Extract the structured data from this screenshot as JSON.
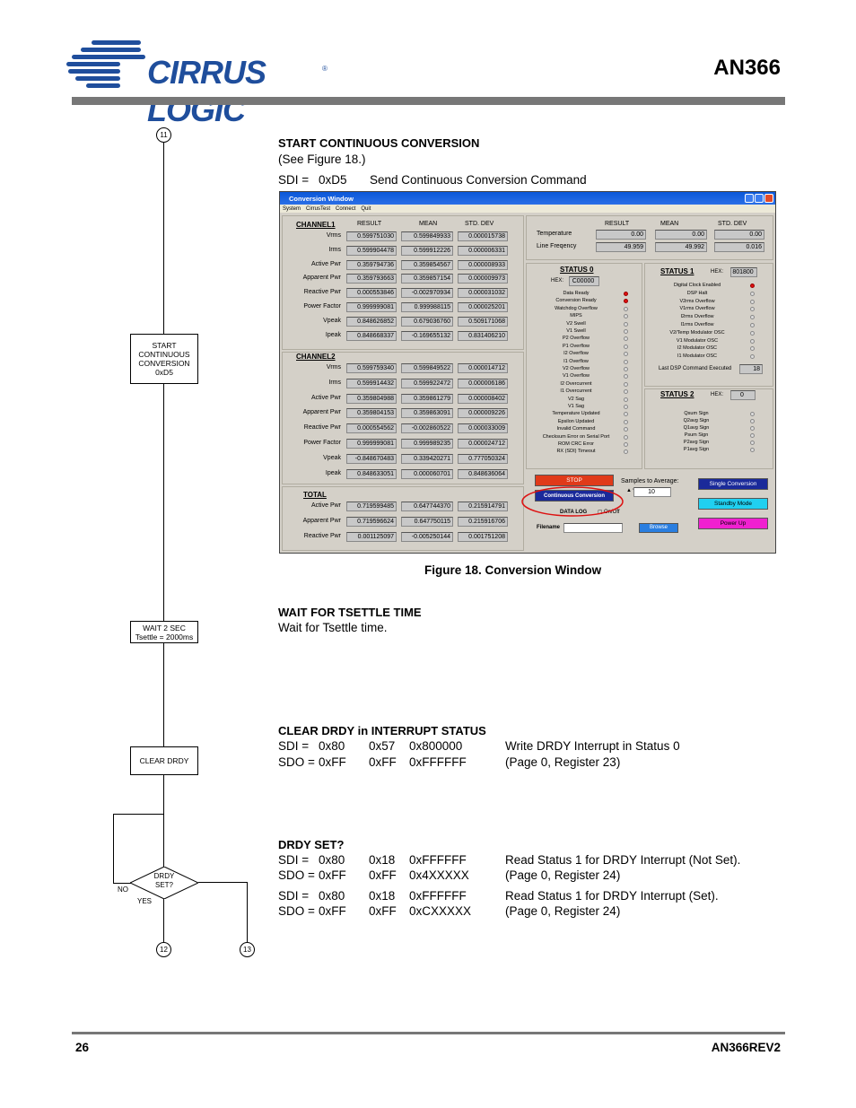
{
  "header": {
    "logo": "CIRRUS LOGIC",
    "logo_mark": "®",
    "doc": "AN366"
  },
  "footer": {
    "page": "26",
    "rev": "AN366REV2"
  },
  "flow": {
    "conn_top": "11",
    "box1": [
      "START",
      "CONTINUOUS",
      "CONVERSION",
      "0xD5"
    ],
    "box2": [
      "WAIT 2 SEC",
      "Tsettle = 2000ms"
    ],
    "box3": "CLEAR DRDY",
    "diamond": [
      "DRDY",
      "SET?"
    ],
    "no": "NO",
    "yes": "YES",
    "conn_b1": "12",
    "conn_b2": "13"
  },
  "sec1": {
    "title": "START CONTINUOUS CONVERSION",
    "sub": "(See Figure 18.)",
    "sdi_label": "SDI =",
    "sdi_val": "0xD5",
    "sdi_desc": "Send Continuous Conversion Command"
  },
  "figure_caption": "Figure 18.  Conversion Window",
  "sec2": {
    "title": "WAIT FOR TSETTLE TIME",
    "text": "Wait for Tsettle time."
  },
  "sec3": {
    "title": "CLEAR DRDY in INTERRUPT STATUS",
    "rows": [
      [
        "SDI =",
        "0x80",
        "0x57",
        "0x800000",
        "Write DRDY Interrupt in Status 0"
      ],
      [
        "SDO =",
        "0xFF",
        "0xFF",
        "0xFFFFFF",
        "(Page 0, Register 23)"
      ]
    ]
  },
  "sec4": {
    "title": "DRDY SET?",
    "rows": [
      [
        "SDI =",
        "0x80",
        "0x18",
        "0xFFFFFF",
        "Read Status 1 for DRDY Interrupt (Not Set)."
      ],
      [
        "SDO =",
        "0xFF",
        "0xFF",
        "0x4XXXXX",
        "(Page 0, Register 24)"
      ],
      [
        "SDI =",
        "0x80",
        "0x18",
        "0xFFFFFF",
        "Read Status 1 for DRDY Interrupt (Set)."
      ],
      [
        "SDO =",
        "0xFF",
        "0xFF",
        "0xCXXXXX",
        "(Page 0, Register 24)"
      ]
    ]
  },
  "window": {
    "title": "Conversion Window",
    "menu": [
      "System",
      "CirrusTest",
      "Connect",
      "Quit"
    ],
    "col_headers": [
      "RESULT",
      "MEAN",
      "STD. DEV"
    ],
    "ch1": {
      "label": "CHANNEL1",
      "rows": [
        [
          "Vrms",
          "0.599751030",
          "0.599849933",
          "0.000015738"
        ],
        [
          "Irms",
          "0.599904478",
          "0.599912226",
          "0.000006331"
        ],
        [
          "Active Pwr",
          "0.359794736",
          "0.359854567",
          "0.000008933"
        ],
        [
          "Apparent Pwr",
          "0.359793663",
          "0.359857154",
          "0.000009973"
        ],
        [
          "Reactive Pwr",
          "0.000553846",
          "-0.002970934",
          "0.000031032"
        ],
        [
          "Power Factor",
          "0.999999081",
          "0.999988115",
          "0.000025201"
        ],
        [
          "Vpeak",
          "0.848626852",
          "0.679036760",
          "0.509171068"
        ],
        [
          "Ipeak",
          "0.848668337",
          "-0.169655132",
          "0.831406210"
        ]
      ]
    },
    "ch2": {
      "label": "CHANNEL2",
      "rows": [
        [
          "Vrms",
          "0.599759340",
          "0.599849522",
          "0.000014712"
        ],
        [
          "Irms",
          "0.599914432",
          "0.599922472",
          "0.000006186"
        ],
        [
          "Active Pwr",
          "0.359804988",
          "0.359861279",
          "0.000008402"
        ],
        [
          "Apparent Pwr",
          "0.359804153",
          "0.359863091",
          "0.000009226"
        ],
        [
          "Reactive Pwr",
          "0.000554562",
          "-0.002860522",
          "0.000033009"
        ],
        [
          "Power Factor",
          "0.999999081",
          "0.999989235",
          "0.000024712"
        ],
        [
          "Vpeak",
          "-0.848670483",
          "0.339420271",
          "0.777050324"
        ],
        [
          "Ipeak",
          "0.848633051",
          "0.000060701",
          "0.848636064"
        ]
      ]
    },
    "total": {
      "label": "TOTAL",
      "rows": [
        [
          "Active Pwr",
          "0.719599485",
          "0.647744370",
          "0.215914791"
        ],
        [
          "Apparent Pwr",
          "0.719596624",
          "0.647750115",
          "0.215916706"
        ],
        [
          "Reactive Pwr",
          "0.001125097",
          "-0.005250144",
          "0.001751208"
        ]
      ]
    },
    "temp": {
      "rows": [
        [
          "Temperature",
          "0.00",
          "0.00",
          "0.00"
        ],
        [
          "Line Freqency",
          "49.959",
          "49.992",
          "0.016"
        ]
      ]
    },
    "status0": {
      "label": "STATUS 0",
      "hex_label": "HEX:",
      "hex": "C00000",
      "items": [
        "Data Ready",
        "Conversion Ready",
        "Watchdog Overflow",
        "MIPS",
        "V2 Swell",
        "V1 Swell",
        "P2 Overflow",
        "P1 Overflow",
        "I2 Overflow",
        "I1 Overflow",
        "V2 Overflow",
        "V1 Overflow",
        "I2 Overcurrent",
        "I1 Overcurrent",
        "V2 Sag",
        "V1 Sag",
        "Temperature Updated",
        "Epsilon Updated",
        "Invalid Command",
        "Checksum Error on Serial Port",
        "ROM CRC Error",
        "RX (SDI) Timeout"
      ],
      "on": [
        true,
        true,
        false,
        false,
        false,
        false,
        false,
        false,
        false,
        false,
        false,
        false,
        false,
        false,
        false,
        false,
        false,
        false,
        false,
        false,
        false,
        false
      ]
    },
    "status1": {
      "label": "STATUS 1",
      "hex_label": "HEX:",
      "hex": "801800",
      "items": [
        "Digital Clock Enabled",
        "DSP Halt",
        "V2rms Overflow",
        "V1rms Overflow",
        "I2rms Overflow",
        "I1rms Overflow",
        "V2/Temp Modulator OSC",
        "V1 Modulator OSC",
        "I2 Modulator OSC",
        "I1 Modulator OSC"
      ],
      "on": [
        true,
        false,
        false,
        false,
        false,
        false,
        false,
        false,
        false,
        false
      ],
      "last_label": "Last DSP Command Executed",
      "last_val": "18"
    },
    "status2": {
      "label": "STATUS 2",
      "hex_label": "HEX:",
      "hex": "0",
      "items": [
        "Qsum Sign",
        "Q2avg Sign",
        "Q1avg Sign",
        "Psum Sign",
        "P2avg Sign",
        "P1avg Sign"
      ]
    },
    "controls": {
      "stop": "STOP",
      "cont": "Continuous Conversion",
      "samples_label": "Samples to Average:",
      "samples": "10",
      "datalog": "DATA LOG",
      "onoff": "On/Off",
      "filename": "Filename",
      "browse": "Browse",
      "single": "Single Conversion",
      "standby": "Standby Mode",
      "powerup": "Power Up"
    }
  }
}
